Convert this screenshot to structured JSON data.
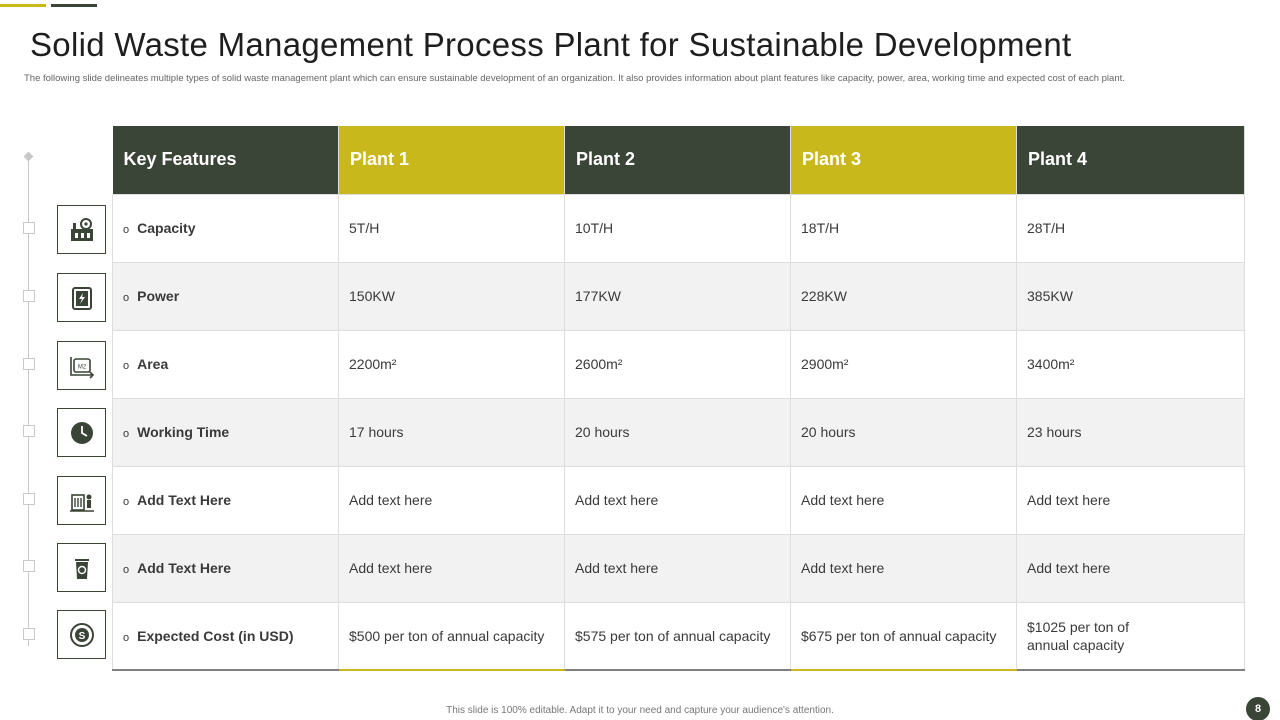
{
  "title": "Solid Waste Management Process Plant for Sustainable Development",
  "subtitle": "The following slide delineates multiple types of solid waste management plant which can ensure sustainable development of an organization. It also provides information about plant features like capacity, power, area, working time and expected cost of each plant.",
  "table": {
    "headers": [
      "Key Features",
      "Plant 1",
      "Plant 2",
      "Plant 3",
      "Plant 4"
    ],
    "rows": [
      {
        "feature": "Capacity",
        "icon": "factory-gear-icon",
        "values": [
          "5T/H",
          "10T/H",
          "18T/H",
          "28T/H"
        ]
      },
      {
        "feature": "Power",
        "icon": "battery-charge-icon",
        "values": [
          "150KW",
          "177KW",
          "228KW",
          "385KW"
        ]
      },
      {
        "feature": "Area",
        "icon": "area-m2-icon",
        "values": [
          "2200m²",
          "2600m²",
          "2900m²",
          "3400m²"
        ]
      },
      {
        "feature": "Working Time",
        "icon": "clock-icon",
        "values": [
          "17 hours",
          "20 hours",
          "20 hours",
          "23 hours"
        ]
      },
      {
        "feature": "Add Text Here",
        "icon": "worker-machine-icon",
        "values": [
          "Add text here",
          "Add text here",
          "Add text here",
          "Add text here"
        ]
      },
      {
        "feature": "Add Text Here",
        "icon": "recycle-bin-icon",
        "values": [
          "Add text here",
          "Add text here",
          "Add text here",
          "Add text here"
        ]
      },
      {
        "feature": "Expected Cost (in USD)",
        "icon": "dollar-cycle-icon",
        "values": [
          "$500 per ton of annual capacity",
          "$575 per ton of annual capacity",
          "$675 per ton of annual capacity",
          "$1025 per ton of annual capacity"
        ]
      }
    ]
  },
  "bullet": "o",
  "footer": "This slide is 100% editable. Adapt it to your need and capture your audience's attention.",
  "page_number": "8",
  "colors": {
    "dark": "#3a4437",
    "olive": "#c8b81c"
  }
}
